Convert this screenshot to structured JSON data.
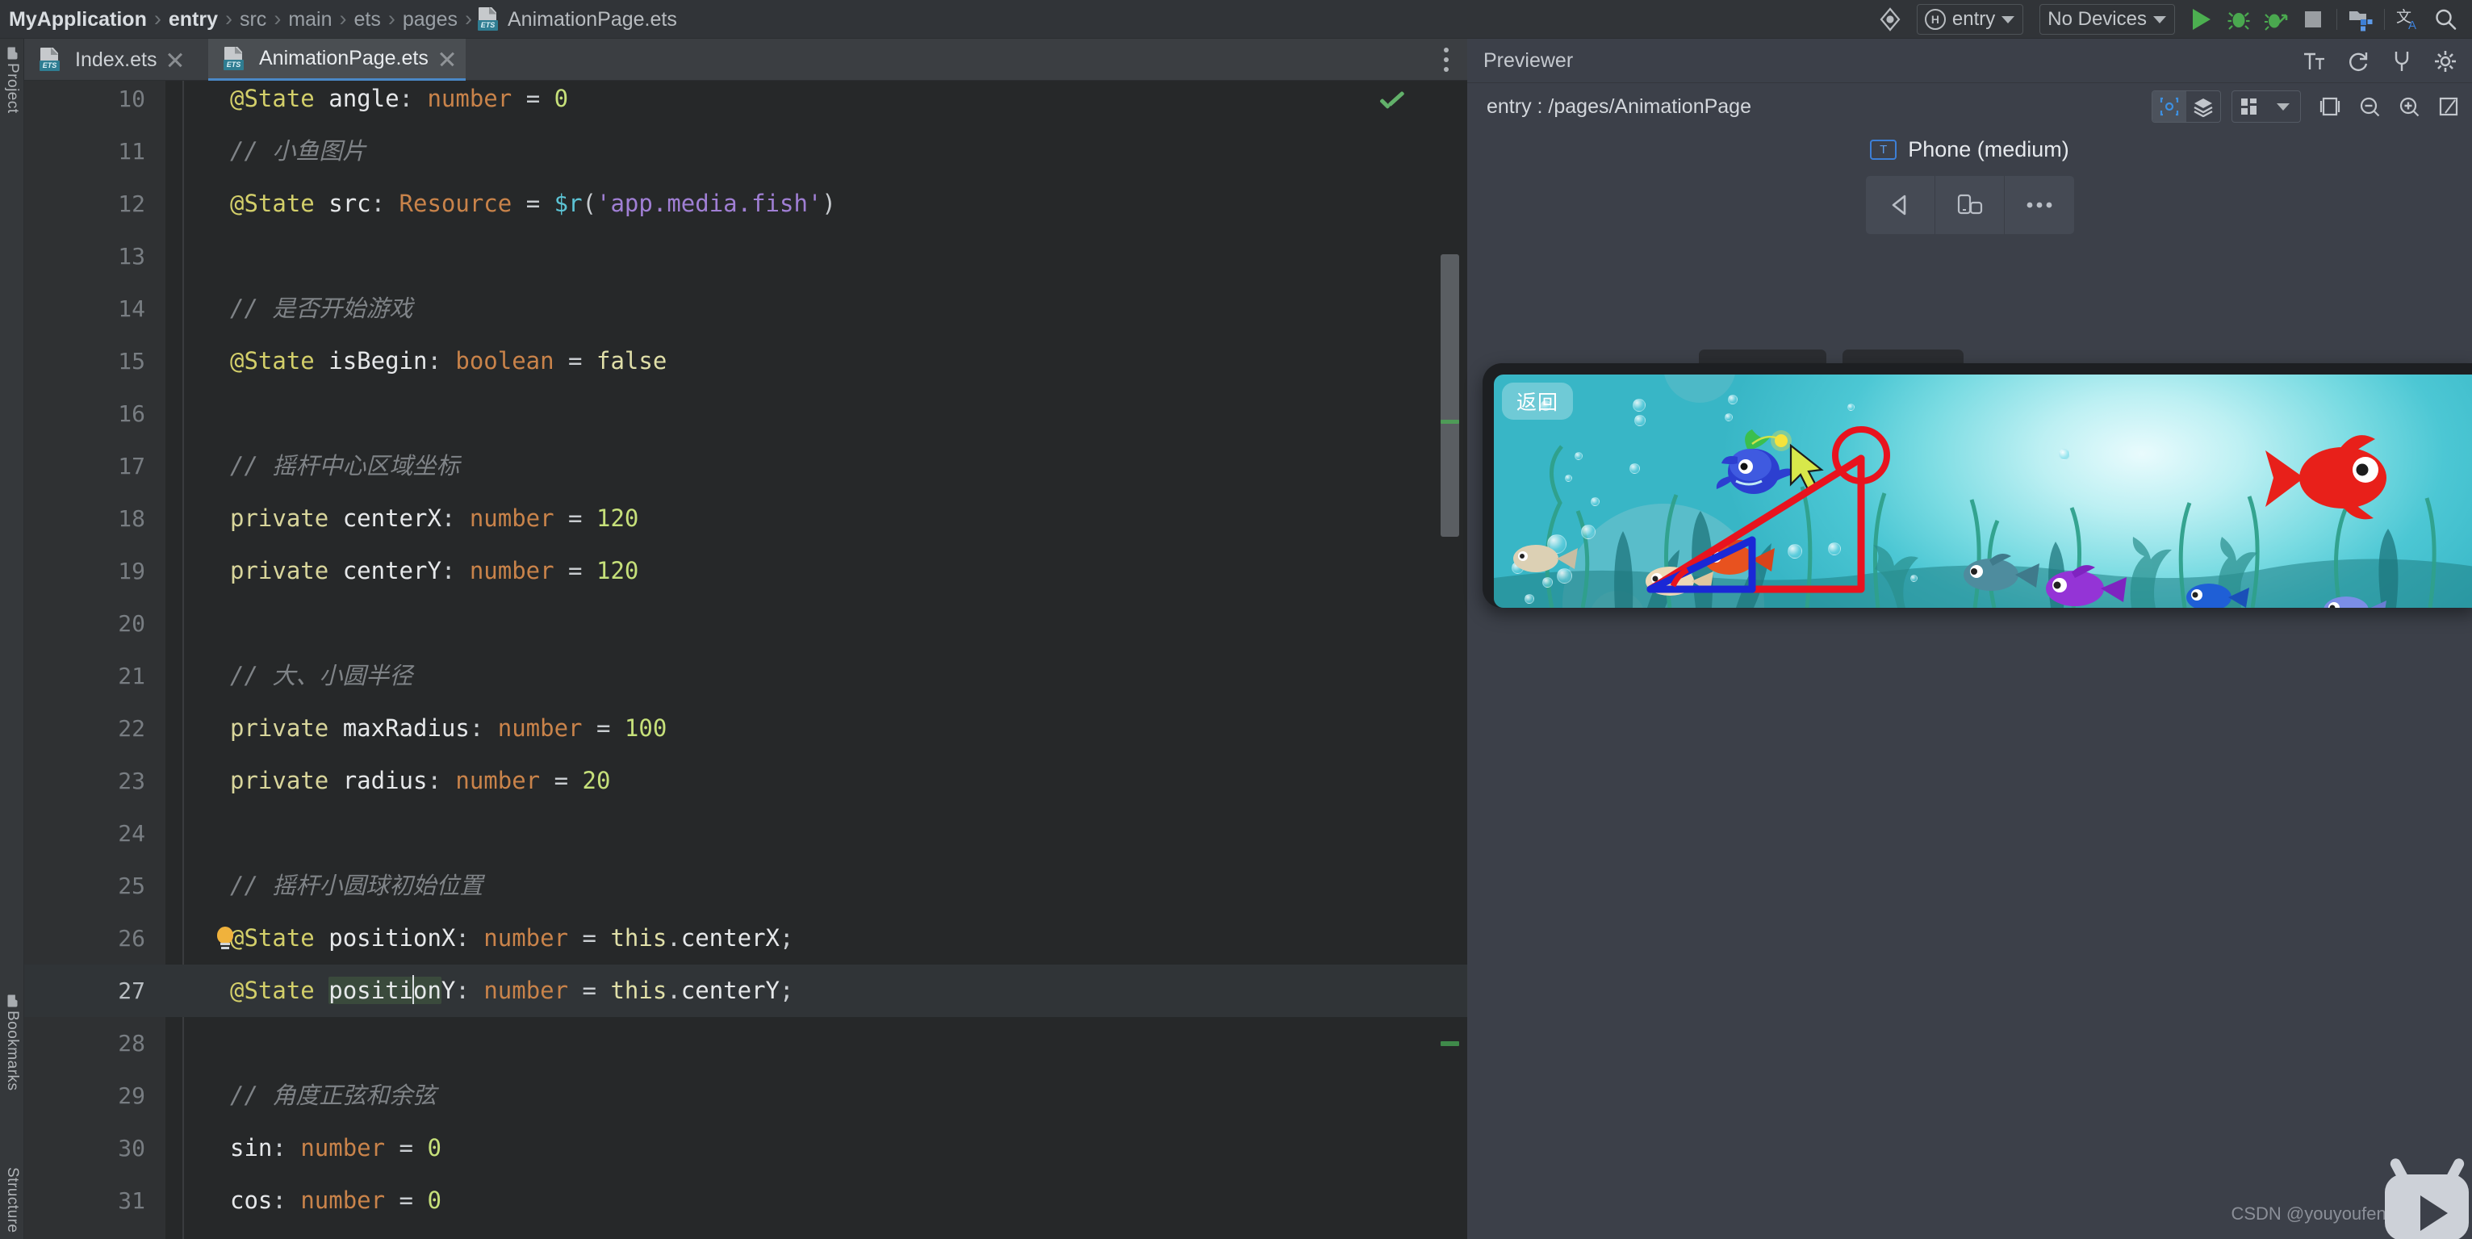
{
  "breadcrumb": {
    "items": [
      "MyApplication",
      "entry",
      "src",
      "main",
      "ets",
      "pages",
      "AnimationPage.ets"
    ],
    "file_icon": "ets-file-icon",
    "separator": "›"
  },
  "toolbar": {
    "target_selector": "entry",
    "target_icon": "harmony-badge-icon",
    "device_selector": "No Devices",
    "run_label": "Run",
    "debug_label": "Debug",
    "profile_label": "Profile",
    "stop_label": "Stop",
    "icons": [
      "device-manager-icon",
      "run-icon",
      "debug-icon",
      "profile-icon",
      "stop-icon",
      "project-structure-icon",
      "translate-icon",
      "search-icon"
    ],
    "accent_run": "#4caf50",
    "accent_blue": "#3d7fd6"
  },
  "left_strip": {
    "tabs": [
      "Project",
      "Bookmarks",
      "Structure"
    ]
  },
  "editor_tabs": {
    "tabs": [
      {
        "label": "Index.ets",
        "active": false,
        "icon": "ets-file-icon"
      },
      {
        "label": "AnimationPage.ets",
        "active": true,
        "icon": "ets-file-icon"
      }
    ],
    "more_label": "⋮"
  },
  "editor": {
    "first_line": 10,
    "current_line": 27,
    "highlighted_word": "position",
    "gutter_bulb_line": 26,
    "inspection_status": "ok",
    "lines": [
      {
        "n": 10,
        "tokens": [
          {
            "t": "@State",
            "c": "t-dec"
          },
          {
            "t": " ",
            "c": "t-op"
          },
          {
            "t": "angle",
            "c": "t-id"
          },
          {
            "t": ": ",
            "c": "t-punc"
          },
          {
            "t": "number",
            "c": "t-typ"
          },
          {
            "t": " = ",
            "c": "t-op"
          },
          {
            "t": "0",
            "c": "t-num"
          }
        ]
      },
      {
        "n": 11,
        "tokens": [
          {
            "t": "// 小鱼图片",
            "c": "t-cmt"
          }
        ]
      },
      {
        "n": 12,
        "tokens": [
          {
            "t": "@State",
            "c": "t-dec"
          },
          {
            "t": " ",
            "c": "t-op"
          },
          {
            "t": "src",
            "c": "t-id"
          },
          {
            "t": ": ",
            "c": "t-punc"
          },
          {
            "t": "Resource",
            "c": "t-typ"
          },
          {
            "t": " = ",
            "c": "t-op"
          },
          {
            "t": "$r",
            "c": "t-fn"
          },
          {
            "t": "(",
            "c": "t-punc"
          },
          {
            "t": "'app.media.fish'",
            "c": "t-str"
          },
          {
            "t": ")",
            "c": "t-punc"
          }
        ]
      },
      {
        "n": 13,
        "tokens": []
      },
      {
        "n": 14,
        "tokens": [
          {
            "t": "// 是否开始游戏",
            "c": "t-cmt"
          }
        ]
      },
      {
        "n": 15,
        "tokens": [
          {
            "t": "@State",
            "c": "t-dec"
          },
          {
            "t": " ",
            "c": "t-op"
          },
          {
            "t": "isBegin",
            "c": "t-id"
          },
          {
            "t": ": ",
            "c": "t-punc"
          },
          {
            "t": "boolean",
            "c": "t-typ"
          },
          {
            "t": " = ",
            "c": "t-op"
          },
          {
            "t": "false",
            "c": "t-val"
          }
        ]
      },
      {
        "n": 16,
        "tokens": []
      },
      {
        "n": 17,
        "tokens": [
          {
            "t": "// 摇杆中心区域坐标",
            "c": "t-cmt"
          }
        ]
      },
      {
        "n": 18,
        "tokens": [
          {
            "t": "private",
            "c": "t-kw"
          },
          {
            "t": " ",
            "c": "t-op"
          },
          {
            "t": "centerX",
            "c": "t-id"
          },
          {
            "t": ": ",
            "c": "t-punc"
          },
          {
            "t": "number",
            "c": "t-typ"
          },
          {
            "t": " = ",
            "c": "t-op"
          },
          {
            "t": "120",
            "c": "t-num"
          }
        ]
      },
      {
        "n": 19,
        "tokens": [
          {
            "t": "private",
            "c": "t-kw"
          },
          {
            "t": " ",
            "c": "t-op"
          },
          {
            "t": "centerY",
            "c": "t-id"
          },
          {
            "t": ": ",
            "c": "t-punc"
          },
          {
            "t": "number",
            "c": "t-typ"
          },
          {
            "t": " = ",
            "c": "t-op"
          },
          {
            "t": "120",
            "c": "t-num"
          }
        ]
      },
      {
        "n": 20,
        "tokens": []
      },
      {
        "n": 21,
        "tokens": [
          {
            "t": "// 大、小圆半径",
            "c": "t-cmt"
          }
        ]
      },
      {
        "n": 22,
        "tokens": [
          {
            "t": "private",
            "c": "t-kw"
          },
          {
            "t": " ",
            "c": "t-op"
          },
          {
            "t": "maxRadius",
            "c": "t-id"
          },
          {
            "t": ": ",
            "c": "t-punc"
          },
          {
            "t": "number",
            "c": "t-typ"
          },
          {
            "t": " = ",
            "c": "t-op"
          },
          {
            "t": "100",
            "c": "t-num"
          }
        ]
      },
      {
        "n": 23,
        "tokens": [
          {
            "t": "private",
            "c": "t-kw"
          },
          {
            "t": " ",
            "c": "t-op"
          },
          {
            "t": "radius",
            "c": "t-id"
          },
          {
            "t": ": ",
            "c": "t-punc"
          },
          {
            "t": "number",
            "c": "t-typ"
          },
          {
            "t": " = ",
            "c": "t-op"
          },
          {
            "t": "20",
            "c": "t-num"
          }
        ]
      },
      {
        "n": 24,
        "tokens": []
      },
      {
        "n": 25,
        "tokens": [
          {
            "t": "// 摇杆小圆球初始位置",
            "c": "t-cmt"
          }
        ]
      },
      {
        "n": 26,
        "tokens": [
          {
            "t": "@State",
            "c": "t-dec"
          },
          {
            "t": " ",
            "c": "t-op"
          },
          {
            "t": "positionX",
            "c": "t-id"
          },
          {
            "t": ": ",
            "c": "t-punc"
          },
          {
            "t": "number",
            "c": "t-typ"
          },
          {
            "t": " = ",
            "c": "t-op"
          },
          {
            "t": "this",
            "c": "t-this"
          },
          {
            "t": ".",
            "c": "t-punc"
          },
          {
            "t": "centerX",
            "c": "t-id"
          },
          {
            "t": ";",
            "c": "t-punc"
          }
        ]
      },
      {
        "n": 27,
        "tokens": [
          {
            "t": "@State",
            "c": "t-dec"
          },
          {
            "t": " ",
            "c": "t-op"
          },
          {
            "t": "positionY",
            "c": "t-id",
            "hl": "position"
          },
          {
            "t": ": ",
            "c": "t-punc"
          },
          {
            "t": "number",
            "c": "t-typ"
          },
          {
            "t": " = ",
            "c": "t-op"
          },
          {
            "t": "this",
            "c": "t-this"
          },
          {
            "t": ".",
            "c": "t-punc"
          },
          {
            "t": "centerY",
            "c": "t-id"
          },
          {
            "t": ";",
            "c": "t-punc"
          }
        ]
      },
      {
        "n": 28,
        "tokens": []
      },
      {
        "n": 29,
        "tokens": [
          {
            "t": "// 角度正弦和余弦",
            "c": "t-cmt"
          }
        ]
      },
      {
        "n": 30,
        "tokens": [
          {
            "t": "sin",
            "c": "t-id"
          },
          {
            "t": ": ",
            "c": "t-punc"
          },
          {
            "t": "number",
            "c": "t-typ"
          },
          {
            "t": " = ",
            "c": "t-op"
          },
          {
            "t": "0",
            "c": "t-num"
          }
        ]
      },
      {
        "n": 31,
        "tokens": [
          {
            "t": "cos",
            "c": "t-id"
          },
          {
            "t": ": ",
            "c": "t-punc"
          },
          {
            "t": "number",
            "c": "t-typ"
          },
          {
            "t": " = ",
            "c": "t-op"
          },
          {
            "t": "0",
            "c": "t-num"
          }
        ]
      }
    ]
  },
  "previewer": {
    "title": "Previewer",
    "path": "entry : /pages/AnimationPage",
    "head_icons": [
      "font-size-icon",
      "refresh-icon",
      "plug-icon",
      "settings-icon"
    ],
    "sub_icons": [
      "inspector-icon",
      "layers-icon",
      "multi-device-icon",
      "chevron-down-icon",
      "frame-icon",
      "zoom-out-icon",
      "zoom-in-icon",
      "fit-screen-icon"
    ],
    "device_name": "Phone (medium)",
    "device_chip": "T",
    "device_buttons": [
      "back-icon",
      "rotate-device-icon",
      "more-icon"
    ],
    "screen": {
      "back_button": "返回",
      "overlay": {
        "big_circle_color": "#e8131e",
        "line_color_primary": "#e8131e",
        "line_color_secondary": "#1a28d6"
      }
    }
  },
  "watermark": {
    "text": "CSDN @youyoufenglai",
    "logo": "bilibili-tv-icon"
  }
}
